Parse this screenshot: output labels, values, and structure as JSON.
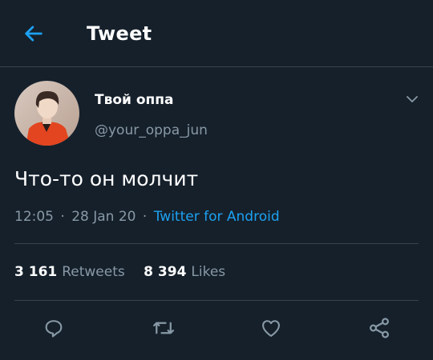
{
  "header": {
    "title": "Tweet",
    "back_icon": "arrow-left-icon"
  },
  "accent_color": "#1da1f2",
  "tweet": {
    "display_name": "Твой оппа",
    "handle": "@your_oppa_jun",
    "text": "Что-то он молчит",
    "time": "12:05",
    "date": "28 Jan 20",
    "separator": "·",
    "source": "Twitter for Android",
    "retweets_count": "3 161",
    "retweets_label": "Retweets",
    "likes_count": "8 394",
    "likes_label": "Likes"
  },
  "actions": [
    {
      "name": "reply",
      "icon": "reply-icon"
    },
    {
      "name": "retweet",
      "icon": "retweet-icon"
    },
    {
      "name": "like",
      "icon": "heart-icon"
    },
    {
      "name": "share",
      "icon": "share-icon"
    }
  ]
}
